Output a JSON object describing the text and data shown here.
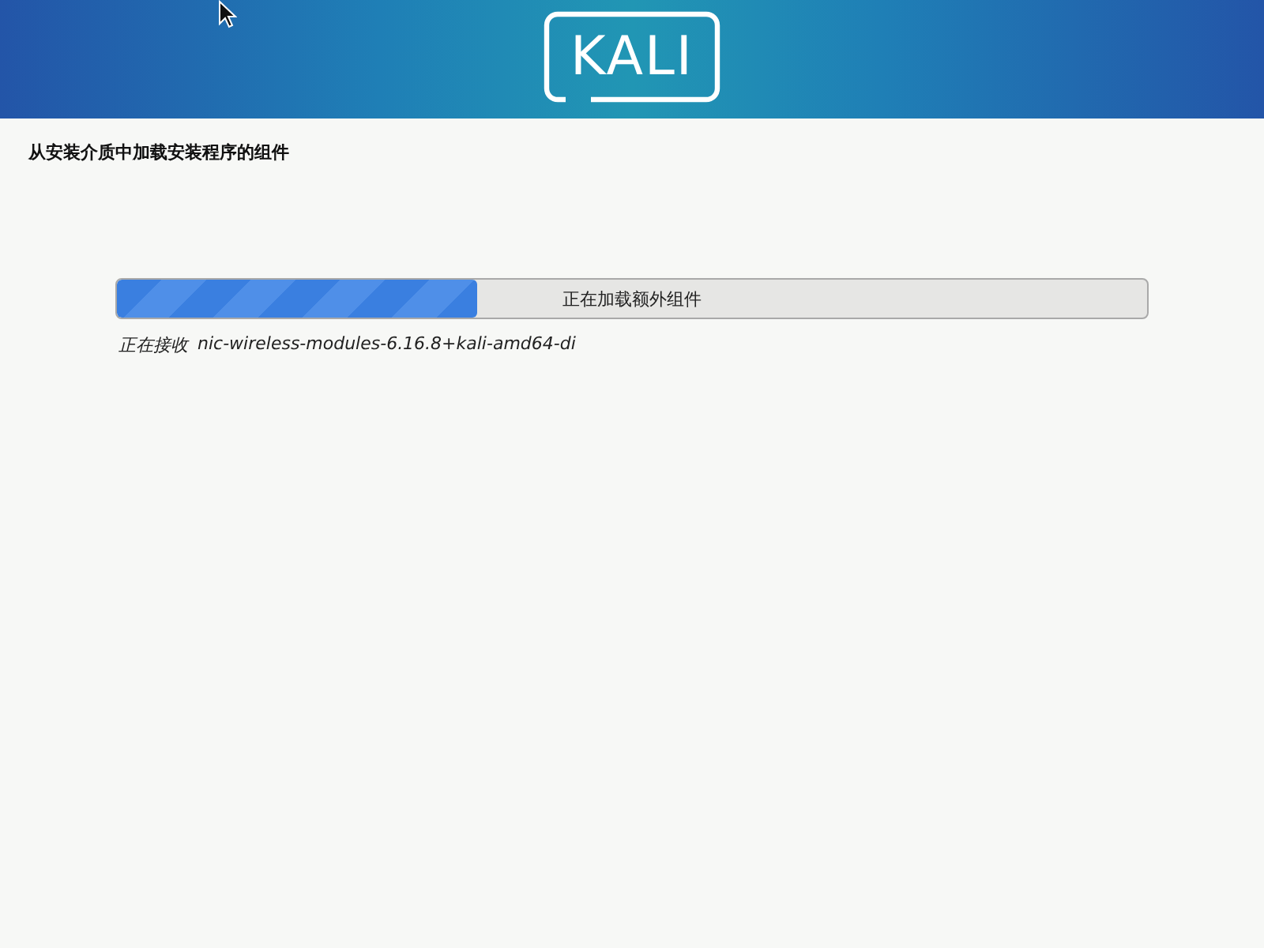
{
  "header": {
    "logo_text": "KALI"
  },
  "title": "从安装介质中加载安装程序的组件",
  "progress": {
    "label": "正在加载额外组件",
    "level": 0.35
  },
  "status": {
    "action": "正在接收",
    "file": "nic-wireless-modules-6.16.8+kali-amd64-di"
  }
}
